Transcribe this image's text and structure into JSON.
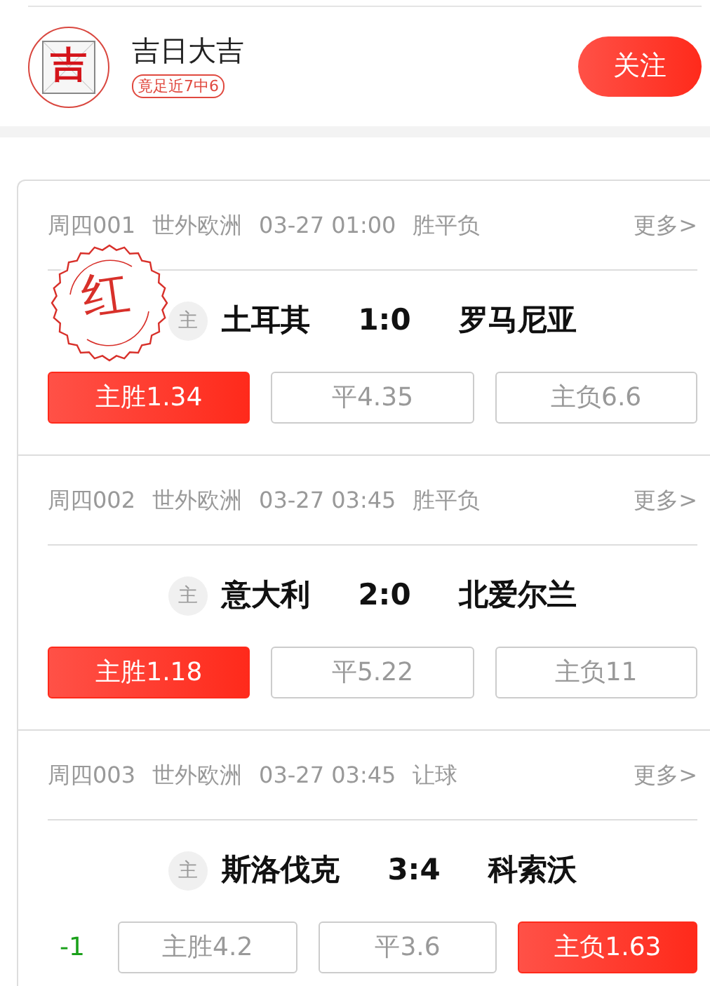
{
  "expert": {
    "avatar_char": "吉",
    "name": "吉日大吉",
    "record": "竟足近7中6",
    "follow": "关注"
  },
  "matches": [
    {
      "code": "周四001",
      "league": "世外欧洲",
      "time": "03-27 01:00",
      "market": "胜平负",
      "more": "更多>",
      "home_tag": "主",
      "home": "土耳其",
      "score": "1:0",
      "away": "罗马尼亚",
      "stamp": "红",
      "odds": [
        {
          "label": "主胜1.34",
          "selected": true
        },
        {
          "label": "平4.35",
          "selected": false
        },
        {
          "label": "主负6.6",
          "selected": false
        }
      ]
    },
    {
      "code": "周四002",
      "league": "世外欧洲",
      "time": "03-27 03:45",
      "market": "胜平负",
      "more": "更多>",
      "home_tag": "主",
      "home": "意大利",
      "score": "2:0",
      "away": "北爱尔兰",
      "odds": [
        {
          "label": "主胜1.18",
          "selected": true
        },
        {
          "label": "平5.22",
          "selected": false
        },
        {
          "label": "主负11",
          "selected": false
        }
      ]
    },
    {
      "code": "周四003",
      "league": "世外欧洲",
      "time": "03-27 03:45",
      "market": "让球",
      "more": "更多>",
      "home_tag": "主",
      "home": "斯洛伐克",
      "score": "3:4",
      "away": "科索沃",
      "handicap": "-1",
      "odds": [
        {
          "label": "主胜4.2",
          "selected": false
        },
        {
          "label": "平3.6",
          "selected": false
        },
        {
          "label": "主负1.63",
          "selected": true
        }
      ]
    }
  ]
}
